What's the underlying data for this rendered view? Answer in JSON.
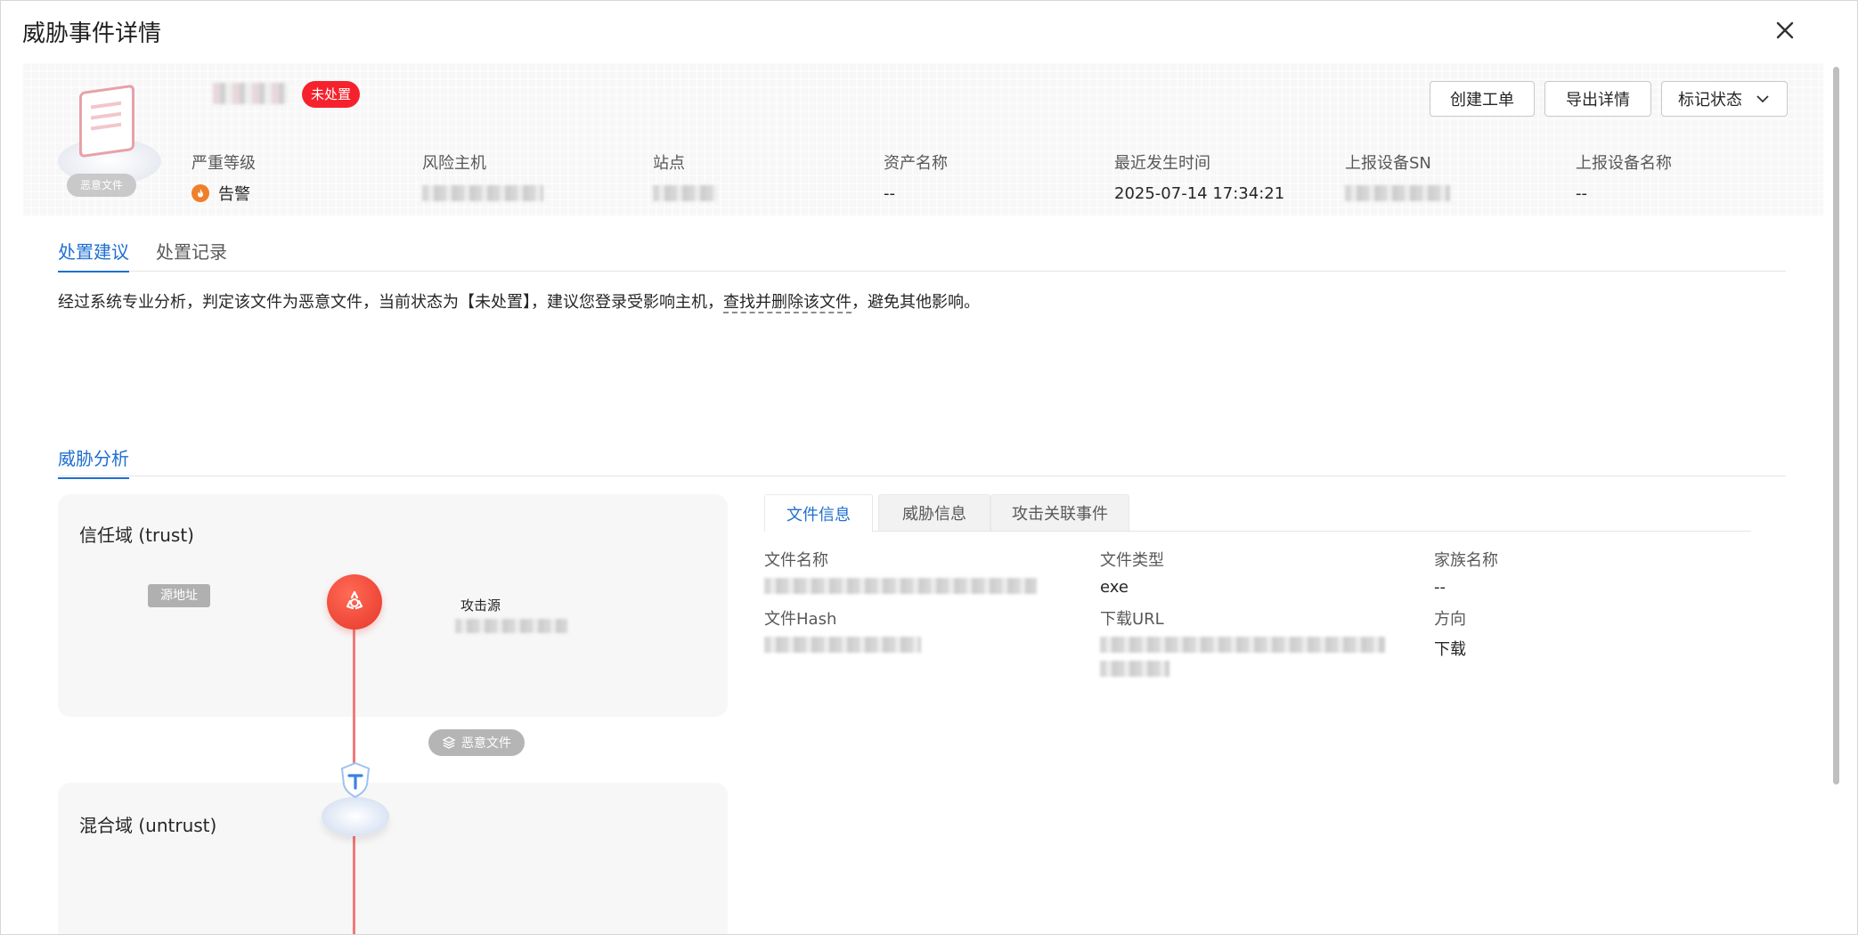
{
  "dialog": {
    "title": "威胁事件详情"
  },
  "header": {
    "file_tag": "恶意文件",
    "status": "未处置",
    "buttons": {
      "create": "创建工单",
      "export": "导出详情",
      "mark": "标记状态"
    },
    "fields": [
      {
        "label": "严重等级",
        "value": "告警"
      },
      {
        "label": "风险主机",
        "value": ""
      },
      {
        "label": "站点",
        "value": ""
      },
      {
        "label": "资产名称",
        "value": "--"
      },
      {
        "label": "最近发生时间",
        "value": "2025-07-14 17:34:21"
      },
      {
        "label": "上报设备SN",
        "value": ""
      },
      {
        "label": "上报设备名称",
        "value": "--"
      }
    ]
  },
  "tabs": [
    "处置建议",
    "处置记录"
  ],
  "advice": {
    "prefix": "经过系统专业分析，判定该文件为恶意文件，当前状态为【未处置】，建议您登录受影响主机，",
    "link": "查找并删除该文件",
    "suffix": "，避免其他影响。"
  },
  "analysis": {
    "title": "威胁分析",
    "trust_zone": "信任域 (trust)",
    "untrust_zone": "混合域 (untrust)",
    "source_tag": "源地址",
    "attack_source": "攻击源",
    "file_pill": "恶意文件"
  },
  "detail_tabs": [
    "文件信息",
    "威胁信息",
    "攻击关联事件"
  ],
  "file_info": {
    "name_label": "文件名称",
    "type_label": "文件类型",
    "type_value": "exe",
    "family_label": "家族名称",
    "family_value": "--",
    "hash_label": "文件Hash",
    "url_label": "下载URL",
    "direction_label": "方向",
    "direction_value": "下载"
  },
  "colors": {
    "accent": "#1f6fd1",
    "danger": "#f5222d",
    "alert": "#f07f2a"
  }
}
